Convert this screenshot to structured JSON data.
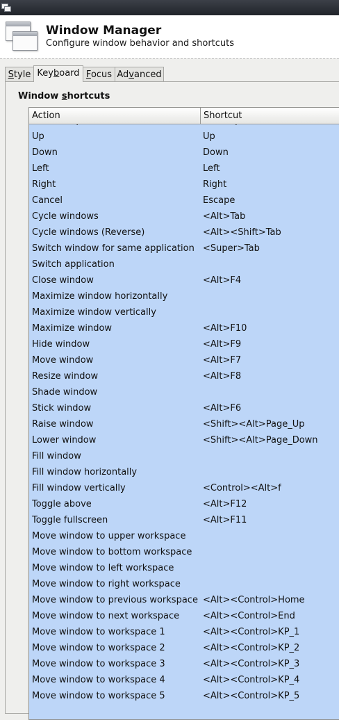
{
  "app": {
    "title": "Window Manager",
    "subtitle": "Configure window behavior and shortcuts"
  },
  "tabs": [
    {
      "pre": "",
      "key": "S",
      "post": "tyle"
    },
    {
      "pre": "Key",
      "key": "b",
      "post": "oard"
    },
    {
      "pre": "",
      "key": "F",
      "post": "ocus"
    },
    {
      "pre": "Ad",
      "key": "v",
      "post": "anced"
    }
  ],
  "active_tab": "Keyboard",
  "section": {
    "pre": "Window ",
    "key": "s",
    "post": "hortcuts"
  },
  "columns": {
    "action": "Action",
    "shortcut": "Shortcut"
  },
  "rows": [
    {
      "action": "Window operations menu",
      "shortcut": "<Alt>space"
    },
    {
      "action": "Up",
      "shortcut": "Up"
    },
    {
      "action": "Down",
      "shortcut": "Down"
    },
    {
      "action": "Left",
      "shortcut": "Left"
    },
    {
      "action": "Right",
      "shortcut": "Right"
    },
    {
      "action": "Cancel",
      "shortcut": "Escape"
    },
    {
      "action": "Cycle windows",
      "shortcut": "<Alt>Tab"
    },
    {
      "action": "Cycle windows (Reverse)",
      "shortcut": "<Alt><Shift>Tab"
    },
    {
      "action": "Switch window for same application",
      "shortcut": "<Super>Tab"
    },
    {
      "action": "Switch application",
      "shortcut": ""
    },
    {
      "action": "Close window",
      "shortcut": "<Alt>F4"
    },
    {
      "action": "Maximize window horizontally",
      "shortcut": ""
    },
    {
      "action": "Maximize window vertically",
      "shortcut": ""
    },
    {
      "action": "Maximize window",
      "shortcut": "<Alt>F10"
    },
    {
      "action": "Hide window",
      "shortcut": "<Alt>F9"
    },
    {
      "action": "Move window",
      "shortcut": "<Alt>F7"
    },
    {
      "action": "Resize window",
      "shortcut": "<Alt>F8"
    },
    {
      "action": "Shade window",
      "shortcut": ""
    },
    {
      "action": "Stick window",
      "shortcut": "<Alt>F6"
    },
    {
      "action": "Raise window",
      "shortcut": "<Shift><Alt>Page_Up"
    },
    {
      "action": "Lower window",
      "shortcut": "<Shift><Alt>Page_Down"
    },
    {
      "action": "Fill window",
      "shortcut": ""
    },
    {
      "action": "Fill window horizontally",
      "shortcut": ""
    },
    {
      "action": "Fill window vertically",
      "shortcut": "<Control><Alt>f"
    },
    {
      "action": "Toggle above",
      "shortcut": "<Alt>F12"
    },
    {
      "action": "Toggle fullscreen",
      "shortcut": "<Alt>F11"
    },
    {
      "action": "Move window to upper workspace",
      "shortcut": ""
    },
    {
      "action": "Move window to bottom workspace",
      "shortcut": ""
    },
    {
      "action": "Move window to left workspace",
      "shortcut": ""
    },
    {
      "action": "Move window to right workspace",
      "shortcut": ""
    },
    {
      "action": "Move window to previous workspace",
      "shortcut": "<Alt><Control>Home"
    },
    {
      "action": "Move window to next workspace",
      "shortcut": "<Alt><Control>End"
    },
    {
      "action": "Move window to workspace 1",
      "shortcut": "<Alt><Control>KP_1"
    },
    {
      "action": "Move window to workspace 2",
      "shortcut": "<Alt><Control>KP_2"
    },
    {
      "action": "Move window to workspace 3",
      "shortcut": "<Alt><Control>KP_3"
    },
    {
      "action": "Move window to workspace 4",
      "shortcut": "<Alt><Control>KP_4"
    },
    {
      "action": "Move window to workspace 5",
      "shortcut": "<Alt><Control>KP_5"
    }
  ],
  "colors": {
    "selection": "#bdd6f8",
    "titlebar": "#2a2e35"
  },
  "icons": {
    "window": "window-manager-icon",
    "menu": "window-menu-icon"
  }
}
